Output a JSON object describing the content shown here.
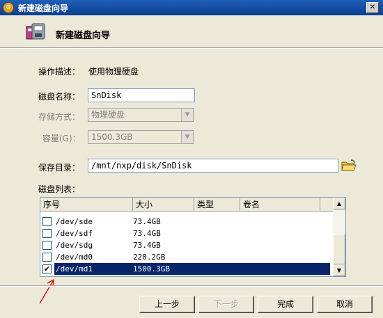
{
  "window": {
    "title": "新建磁盘向导",
    "close_label": "✕"
  },
  "header": {
    "title": "新建磁盘向导"
  },
  "form": {
    "operation_label": "操作描述：",
    "operation_value": "使用物理硬盘",
    "disk_name_label": "磁盘名称：",
    "disk_name_value": "SnDisk",
    "storage_label": "存储方式：",
    "storage_value": "物理硬盘",
    "capacity_label": "容量(G)：",
    "capacity_value": "1500.3GB",
    "save_dir_label": "保存目录：",
    "save_dir_value": "/mnt/nxp/disk/SnDisk",
    "disk_list_label": "磁盘列表："
  },
  "disk_list": {
    "columns": [
      "序号",
      "大小",
      "类型",
      "卷名"
    ],
    "rows": [
      {
        "name": "/dev/sde",
        "size": "73.4GB",
        "type": "",
        "volume": "",
        "checked": false,
        "selected": false
      },
      {
        "name": "/dev/sdf",
        "size": "73.4GB",
        "type": "",
        "volume": "",
        "checked": false,
        "selected": false
      },
      {
        "name": "/dev/sdg",
        "size": "73.4GB",
        "type": "",
        "volume": "",
        "checked": false,
        "selected": false
      },
      {
        "name": "/dev/md0",
        "size": "220.2GB",
        "type": "",
        "volume": "",
        "checked": false,
        "selected": false
      },
      {
        "name": "/dev/md1",
        "size": "1500.3GB",
        "type": "",
        "volume": "",
        "checked": true,
        "selected": true
      }
    ]
  },
  "buttons": {
    "prev": "上一步",
    "next": "下一步",
    "finish": "完成",
    "cancel": "取消"
  },
  "colors": {
    "titlebar": "#0a3f8f",
    "selection": "#0a246a",
    "annotation_arrow": "#e00000"
  }
}
